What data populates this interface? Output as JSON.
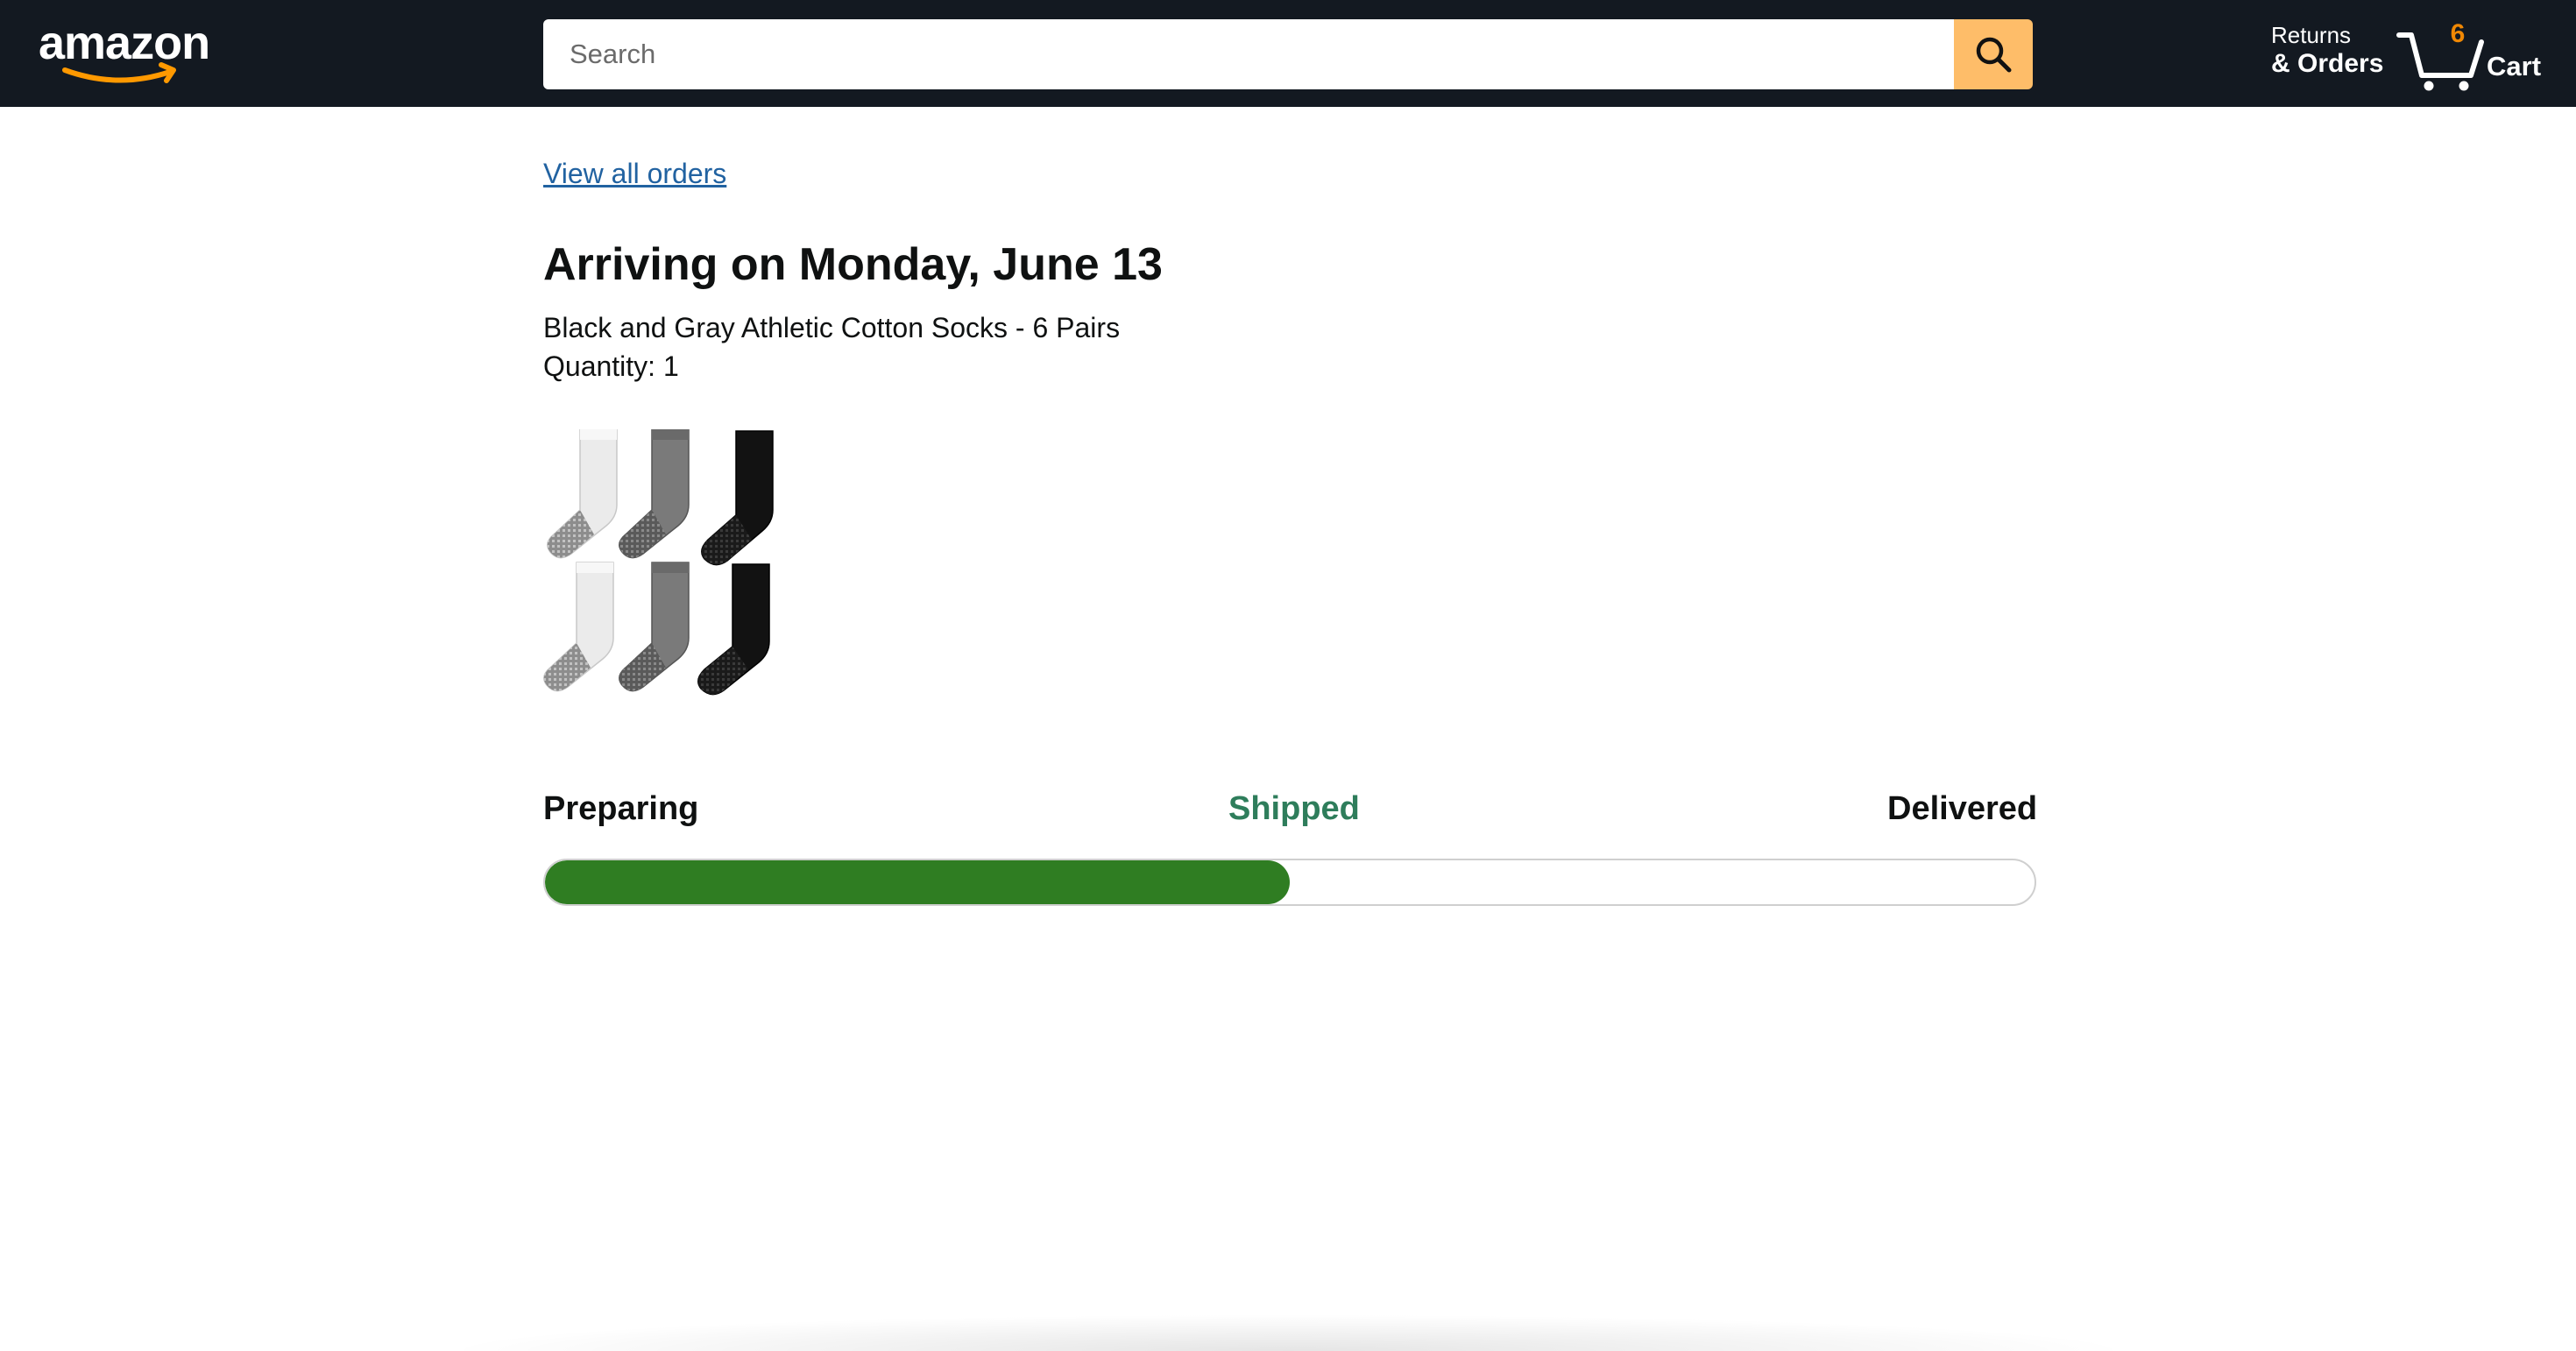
{
  "header": {
    "logo_text": "amazon",
    "search": {
      "placeholder": "Search",
      "value": ""
    },
    "returns": {
      "line1": "Returns",
      "line2": "& Orders"
    },
    "cart": {
      "count": "6",
      "label": "Cart"
    }
  },
  "main": {
    "view_all_orders": "View all orders",
    "arriving": "Arriving on Monday, June 13",
    "product_name": "Black and Gray Athletic Cotton Socks - 6 Pairs",
    "quantity": "Quantity: 1",
    "progress": {
      "steps": [
        "Preparing",
        "Shipped",
        "Delivered"
      ],
      "current_step": "Shipped",
      "fraction": 0.5
    }
  },
  "colors": {
    "header_bg": "#131921",
    "search_button": "#febd69",
    "cart_count": "#f08804",
    "link": "#2162a1",
    "progress_fill": "#2f7d22",
    "current_step_text": "#2e7d5b"
  }
}
